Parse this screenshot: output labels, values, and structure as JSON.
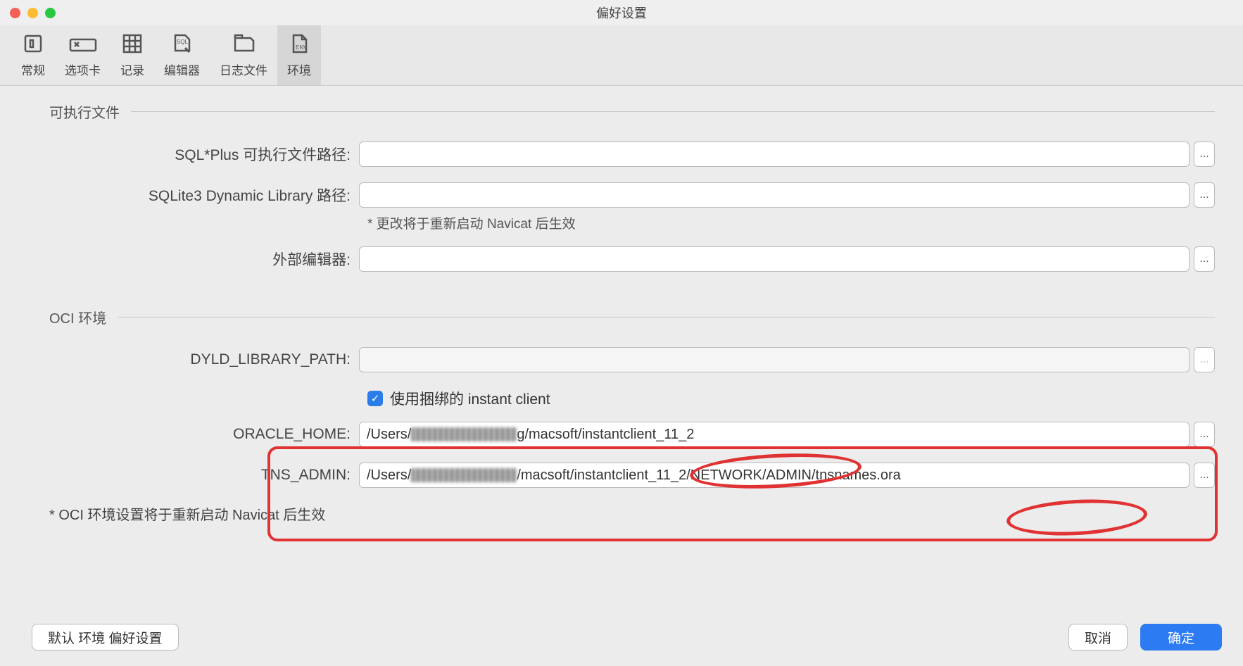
{
  "title": "偏好设置",
  "traffic_colors": {
    "close": "#f55f56",
    "min": "#fcbc2f",
    "max": "#28c940"
  },
  "tabs": [
    {
      "label": "常规",
      "icon": "general-icon"
    },
    {
      "label": "选项卡",
      "icon": "tabs-icon"
    },
    {
      "label": "记录",
      "icon": "records-icon"
    },
    {
      "label": "编辑器",
      "icon": "editor-icon"
    },
    {
      "label": "日志文件",
      "icon": "logfile-icon"
    },
    {
      "label": "环境",
      "icon": "env-icon"
    }
  ],
  "active_tab": 5,
  "groups": {
    "exec": {
      "title": "可执行文件",
      "fields": {
        "sqlplus_label": "SQL*Plus 可执行文件路径:",
        "sqlplus_value": "",
        "sqlite_label": "SQLite3 Dynamic Library 路径:",
        "sqlite_value": "",
        "sqlite_note": "* 更改将于重新启动 Navicat 后生效",
        "exteditor_label": "外部编辑器:",
        "exteditor_value": ""
      }
    },
    "oci": {
      "title": "OCI 环境",
      "fields": {
        "dyld_label": "DYLD_LIBRARY_PATH:",
        "dyld_value": "",
        "use_bundled_label": "使用捆绑的 instant client",
        "use_bundled_checked": true,
        "oracle_home_label": "ORACLE_HOME:",
        "oracle_home_prefix": "/Users/",
        "oracle_home_suffix": "g/macsoft/instantclient_11_2",
        "tns_admin_label": "TNS_ADMIN:",
        "tns_admin_prefix": "/Users/",
        "tns_admin_suffix": "/macsoft/instantclient_11_2/NETWORK/ADMIN/tnsnames.ora"
      },
      "note": "* OCI 环境设置将于重新启动 Navicat 后生效"
    }
  },
  "footer": {
    "default_btn": "默认 环境 偏好设置",
    "cancel": "取消",
    "ok": "确定"
  },
  "browse_label": "...",
  "highlights": {
    "box": "oracle-tns-rows",
    "circles": [
      "instantclient_11_2",
      "tnsnames.ora"
    ]
  }
}
